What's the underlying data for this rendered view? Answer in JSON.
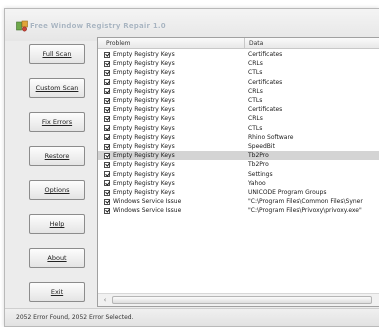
{
  "window": {
    "title": "Free Window Registry Repair 1.0"
  },
  "buttons": [
    {
      "label": "Full Scan",
      "name": "full-scan-button"
    },
    {
      "label": "Custom Scan",
      "name": "custom-scan-button"
    },
    {
      "label": "Fix Errors",
      "name": "fix-errors-button"
    },
    {
      "label": "Restore",
      "name": "restore-button"
    },
    {
      "label": "Options",
      "name": "options-button"
    },
    {
      "label": "Help",
      "name": "help-button"
    },
    {
      "label": "About",
      "name": "about-button"
    },
    {
      "label": "Exit",
      "name": "exit-button"
    }
  ],
  "list": {
    "columns": [
      "Problem",
      "Data"
    ],
    "rows": [
      {
        "problem": "Empty Registry Keys",
        "data": "Certificates",
        "checked": true,
        "selected": false
      },
      {
        "problem": "Empty Registry Keys",
        "data": "CRLs",
        "checked": true,
        "selected": false
      },
      {
        "problem": "Empty Registry Keys",
        "data": "CTLs",
        "checked": true,
        "selected": false
      },
      {
        "problem": "Empty Registry Keys",
        "data": "Certificates",
        "checked": true,
        "selected": false
      },
      {
        "problem": "Empty Registry Keys",
        "data": "CRLs",
        "checked": true,
        "selected": false
      },
      {
        "problem": "Empty Registry Keys",
        "data": "CTLs",
        "checked": true,
        "selected": false
      },
      {
        "problem": "Empty Registry Keys",
        "data": "Certificates",
        "checked": true,
        "selected": false
      },
      {
        "problem": "Empty Registry Keys",
        "data": "CRLs",
        "checked": true,
        "selected": false
      },
      {
        "problem": "Empty Registry Keys",
        "data": "CTLs",
        "checked": true,
        "selected": false
      },
      {
        "problem": "Empty Registry Keys",
        "data": "Rhino Software",
        "checked": true,
        "selected": false
      },
      {
        "problem": "Empty Registry Keys",
        "data": "SpeedBit",
        "checked": true,
        "selected": false
      },
      {
        "problem": "Empty Registry Keys",
        "data": "Tb2Pro",
        "checked": true,
        "selected": true
      },
      {
        "problem": "Empty Registry Keys",
        "data": "Tb2Pro",
        "checked": true,
        "selected": false
      },
      {
        "problem": "Empty Registry Keys",
        "data": "Settings",
        "checked": true,
        "selected": false
      },
      {
        "problem": "Empty Registry Keys",
        "data": "Yahoo",
        "checked": true,
        "selected": false
      },
      {
        "problem": "Empty Registry Keys",
        "data": "UNICODE Program Groups",
        "checked": true,
        "selected": false
      },
      {
        "problem": "Windows Service Issue",
        "data": "\"C:\\Program Files\\Common Files\\Syner",
        "checked": true,
        "selected": false
      },
      {
        "problem": "Windows Service Issue",
        "data": "\"C:\\Program Files\\Privoxy\\privoxy.exe\"",
        "checked": true,
        "selected": false
      }
    ]
  },
  "status": {
    "text": "2052 Error Found,  2052 Error Selected."
  }
}
